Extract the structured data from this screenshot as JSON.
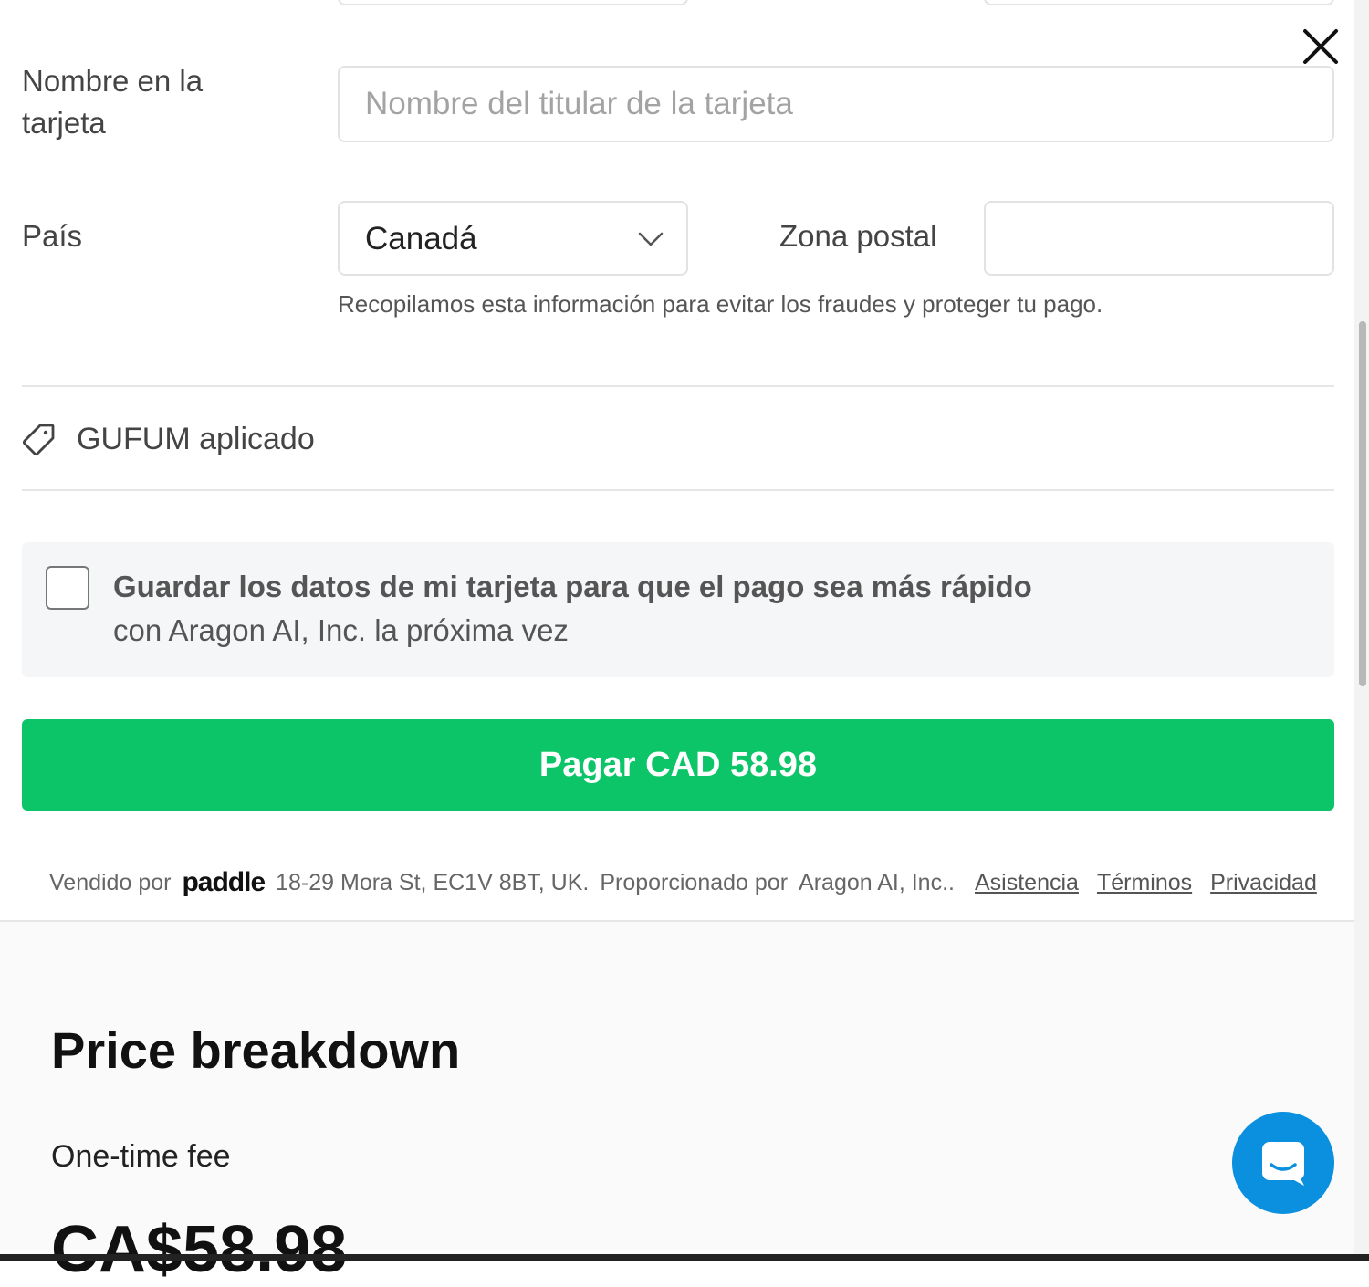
{
  "close_icon": "close-icon",
  "card_name": {
    "label": "Nombre en la tarjeta",
    "placeholder": "Nombre del titular de la tarjeta"
  },
  "country": {
    "label": "País",
    "value": "Canadá",
    "icon": "chevron-down-icon"
  },
  "postal": {
    "label": "Zona postal",
    "value": ""
  },
  "fraud_note": "Recopilamos esta información para evitar los fraudes y proteger tu pago.",
  "coupon": {
    "icon": "tag-icon",
    "text": "GUFUM aplicado"
  },
  "save_card": {
    "checked": false,
    "title": "Guardar los datos de mi tarjeta para que el pago sea más rápido",
    "subtitle": "con Aragon AI, Inc. la próxima vez"
  },
  "pay_button": {
    "label": "Pagar CAD 58.98",
    "color": "#0bc568"
  },
  "footer": {
    "sold_by": "Vendido por",
    "brand": "paddle",
    "address": "18-29 Mora St, EC1V 8BT, UK.",
    "provided_by": "Proporcionado por",
    "company": "Aragon AI, Inc..",
    "links": [
      "Asistencia",
      "Términos",
      "Privacidad"
    ]
  },
  "price_breakdown": {
    "title": "Price breakdown",
    "fee_label": "One-time fee",
    "amount": "CA$58.98"
  },
  "chat_button": {
    "icon": "chat-icon",
    "color": "#0b8fdf"
  }
}
